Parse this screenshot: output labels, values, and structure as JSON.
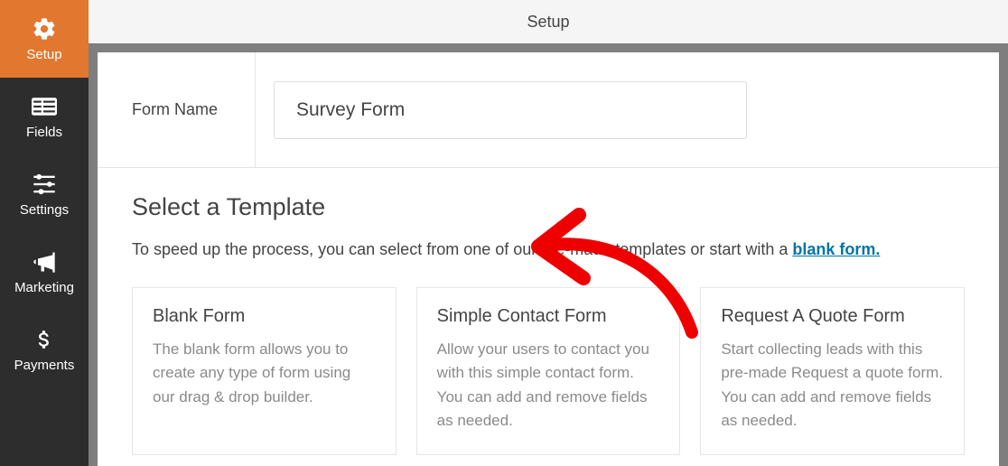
{
  "sidebar": {
    "items": [
      {
        "label": "Setup"
      },
      {
        "label": "Fields"
      },
      {
        "label": "Settings"
      },
      {
        "label": "Marketing"
      },
      {
        "label": "Payments"
      }
    ]
  },
  "topbar": {
    "title": "Setup"
  },
  "form_name": {
    "label": "Form Name",
    "value": "Survey Form"
  },
  "template_section": {
    "heading": "Select a Template",
    "intro_prefix": "To speed up the process, you can select from one of our pre-made templates or start with a ",
    "blank_link": "blank form."
  },
  "templates": [
    {
      "title": "Blank Form",
      "desc": "The blank form allows you to create any type of form using our drag & drop builder."
    },
    {
      "title": "Simple Contact Form",
      "desc": "Allow your users to contact you with this simple contact form. You can add and remove fields as needed."
    },
    {
      "title": "Request A Quote Form",
      "desc": "Start collecting leads with this pre-made Request a quote form. You can add and remove fields as needed."
    }
  ]
}
